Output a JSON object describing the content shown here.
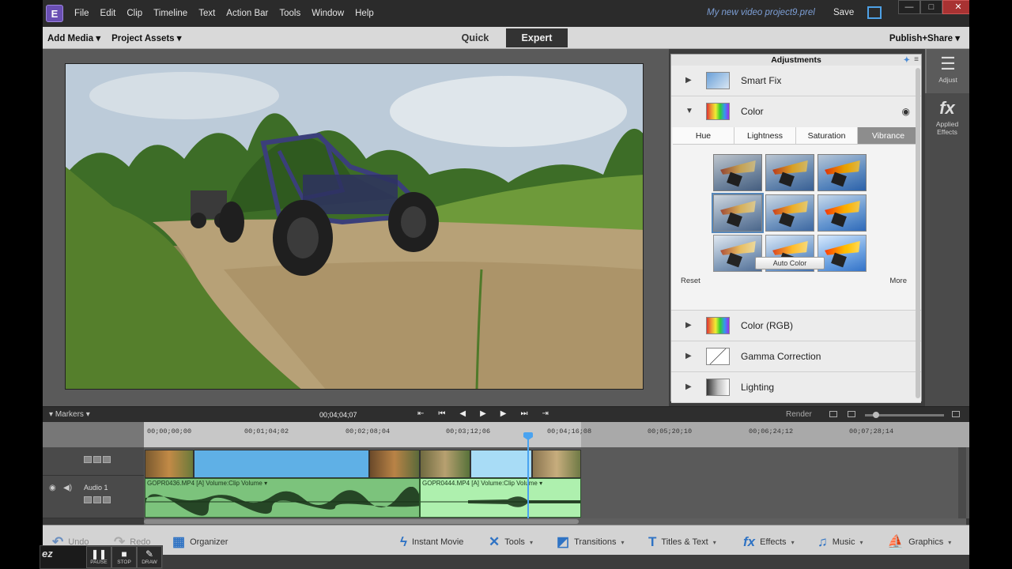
{
  "menubar": {
    "logo": "E",
    "items": [
      "File",
      "Edit",
      "Clip",
      "Timeline",
      "Text",
      "Action Bar",
      "Tools",
      "Window",
      "Help"
    ],
    "project_name": "My new video project9.prel",
    "save": "Save",
    "window_controls": {
      "minimize": "—",
      "maximize": "□",
      "close": "✕"
    }
  },
  "toolbar": {
    "add_media": "Add Media ▾",
    "project_assets": "Project Assets ▾",
    "modes": [
      "Quick",
      "Expert"
    ],
    "active_mode": "Expert",
    "publish": "Publish+Share ▾"
  },
  "adjustments": {
    "title": "Adjustments",
    "rows_top": [
      {
        "label": "Smart Fix",
        "expanded": false
      },
      {
        "label": "Color",
        "expanded": true
      }
    ],
    "color_tabs": [
      "Hue",
      "Lightness",
      "Saturation",
      "Vibrance"
    ],
    "active_color_tab": "Vibrance",
    "variation_count": 9,
    "selected_variation": 3,
    "auto_color": "Auto Color",
    "reset": "Reset",
    "more": "More",
    "rows_bottom": [
      {
        "label": "Color (RGB)"
      },
      {
        "label": "Gamma Correction"
      },
      {
        "label": "Lighting"
      }
    ]
  },
  "right_strip": {
    "adjust": "Adjust",
    "applied_effects": "Applied Effects"
  },
  "timeline": {
    "markers": "Markers",
    "timecode": "00;04;04;07",
    "render": "Render",
    "ruler_ticks": [
      "00;00;00;00",
      "00;01;04;02",
      "00;02;08;04",
      "00;03;12;06",
      "00;04;16;08",
      "00;05;20;10",
      "00;06;24;12",
      "00;07;28;14"
    ],
    "audio_track_name": "Audio 1",
    "audio_clip_1": "GOPR0436.MP4 [A]  Volume:Clip Volume ▾",
    "audio_clip_2": "GOPR0444.MP4 [A]  Volume:Clip Volume ▾"
  },
  "action_bar": {
    "undo": "Undo",
    "redo": "Redo",
    "organizer": "Organizer",
    "instant_movie": "Instant Movie",
    "tools": "Tools",
    "transitions": "Transitions",
    "titles_text": "Titles & Text",
    "effects": "Effects",
    "music": "Music",
    "graphics": "Graphics"
  },
  "recorder": {
    "logo": "ez",
    "pause": "PAUSE",
    "stop": "STOP",
    "draw": "DRAW"
  }
}
